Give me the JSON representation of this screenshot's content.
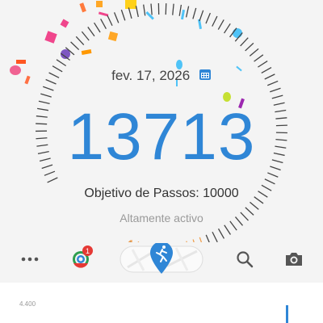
{
  "header": {
    "date": "fev. 17, 2026",
    "steps": "13713",
    "goal_text": "Objetivo de Passos: 10000",
    "activity_level": "Altamente activo",
    "calendar_icon": "calendar-icon"
  },
  "progress": {
    "steps": 13713,
    "goal": 10000
  },
  "toolbar": {
    "more_icon": "more-dots-icon",
    "coach_icon": "coach-target-icon",
    "coach_badge": "1",
    "map_icon": "running-map-icon",
    "search_icon": "search-icon",
    "camera_icon": "camera-icon"
  },
  "chart": {
    "y_tick": "4.400"
  },
  "colors": {
    "accent": "#2f86d6",
    "ticks": "#444444",
    "goal_ticks": "#f0a050",
    "badge": "#e53935"
  }
}
